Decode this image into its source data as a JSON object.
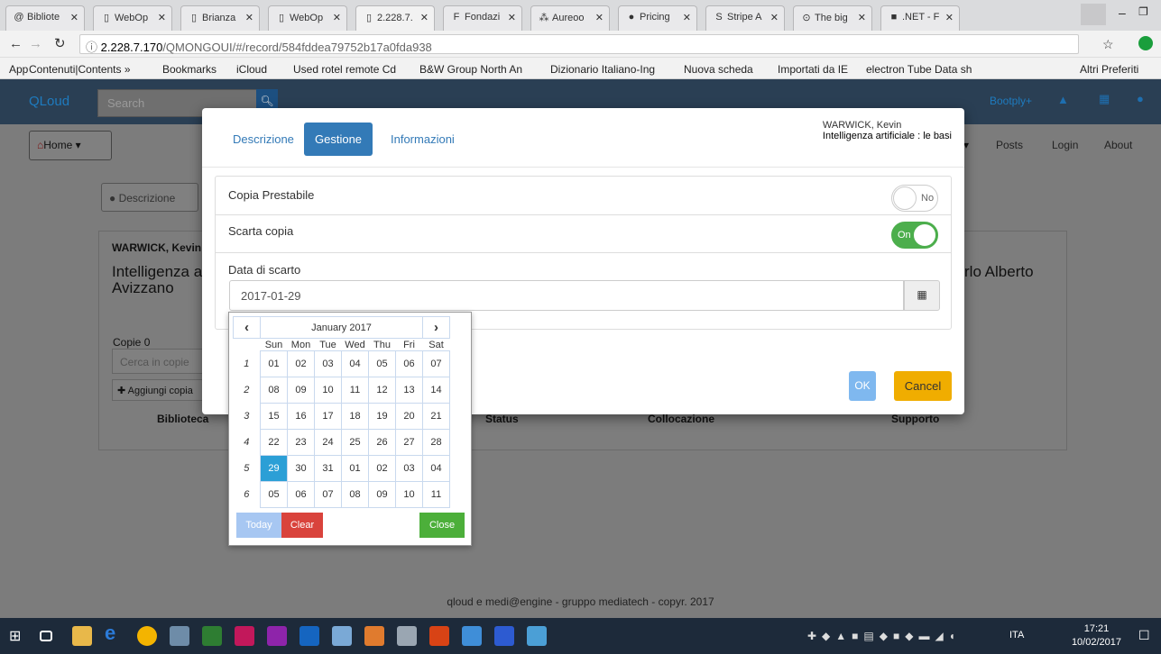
{
  "browser": {
    "tabs": [
      {
        "icon": "@",
        "label": "Bibliote"
      },
      {
        "icon": "▯",
        "label": "WebOp"
      },
      {
        "icon": "▯",
        "label": "Brianza"
      },
      {
        "icon": "▯",
        "label": "WebOp"
      },
      {
        "icon": "▯",
        "label": "2.228.7."
      },
      {
        "icon": "F",
        "label": "Fondazi"
      },
      {
        "icon": "⁂",
        "label": "Aureoo"
      },
      {
        "icon": "●",
        "label": "Pricing"
      },
      {
        "icon": "S",
        "label": "Stripe A"
      },
      {
        "icon": "⊙",
        "label": "The big"
      },
      {
        "icon": "■",
        "label": ".NET - F"
      }
    ],
    "url_host": "2.228.7.170",
    "url_path": "/QMONGOUI/#/record/584fddea79752b17a0fda938",
    "bookmarks": [
      "App",
      "Contenuti|Contents »",
      "Bookmarks",
      "iCloud",
      "Used rotel remote Cd",
      "B&W Group North An",
      "Dizionario Italiano-Ing",
      "Nuova scheda",
      "Importati da IE",
      "electron Tube Data sh",
      "Altri Preferiti"
    ]
  },
  "app": {
    "brand": "QLoud",
    "search_placeholder": "Search",
    "right_nav": [
      "Bootply+",
      "Posts",
      "Login",
      "About"
    ],
    "home": "Home",
    "bg_desc_btn": "Descrizione",
    "bg_author": "WARWICK, Kevin",
    "bg_title_1": "Intelligenza a",
    "bg_title_2": "Avizzano",
    "bg_right": "rlo Alberto",
    "copie": "Copie 0",
    "cerca_copie": "Cerca in copie",
    "aggiungi": "Aggiungi copia",
    "cols": [
      "Biblioteca",
      "Status",
      "Collocazione",
      "Supporto"
    ],
    "footer": "qloud e medi@engine - gruppo mediatech - copyr. 2017"
  },
  "modal": {
    "tabs": [
      "Descrizione",
      "Gestione",
      "Informazioni"
    ],
    "author": "WARWICK, Kevin",
    "title": "Intelligenza artificiale : le basi",
    "copia_prestabile": "Copia Prestabile",
    "toggle_no": "No",
    "scarta_copia": "Scarta copia",
    "toggle_on": "On",
    "data_scarto": "Data di scarto",
    "date_value": "2017-01-29",
    "ok": "OK",
    "cancel": "Cancel"
  },
  "datepicker": {
    "month": "January 2017",
    "prev": "‹",
    "next": "›",
    "dow": [
      "Sun",
      "Mon",
      "Tue",
      "Wed",
      "Thu",
      "Fri",
      "Sat"
    ],
    "weeks": [
      {
        "n": "1",
        "days": [
          "01",
          "02",
          "03",
          "04",
          "05",
          "06",
          "07"
        ]
      },
      {
        "n": "2",
        "days": [
          "08",
          "09",
          "10",
          "11",
          "12",
          "13",
          "14"
        ]
      },
      {
        "n": "3",
        "days": [
          "15",
          "16",
          "17",
          "18",
          "19",
          "20",
          "21"
        ]
      },
      {
        "n": "4",
        "days": [
          "22",
          "23",
          "24",
          "25",
          "26",
          "27",
          "28"
        ]
      },
      {
        "n": "5",
        "days": [
          "29",
          "30",
          "31",
          "01",
          "02",
          "03",
          "04"
        ]
      },
      {
        "n": "6",
        "days": [
          "05",
          "06",
          "07",
          "08",
          "09",
          "10",
          "11"
        ]
      }
    ],
    "selected": "29",
    "today": "Today",
    "clear": "Clear",
    "close": "Close"
  },
  "taskbar": {
    "lang": "ITA",
    "time": "17:21",
    "date": "10/02/2017"
  }
}
